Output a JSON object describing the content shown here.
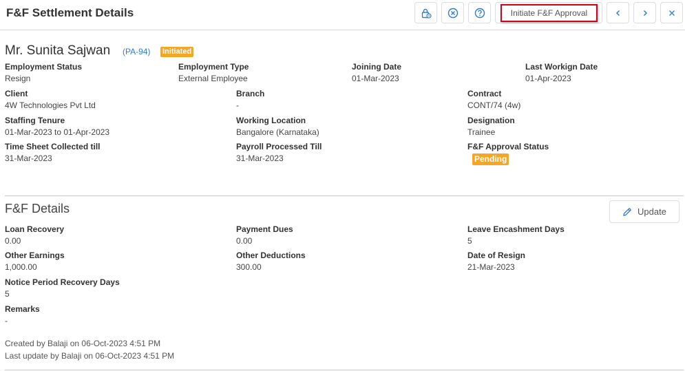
{
  "header": {
    "title": "F&F Settlement Details",
    "initiate_label": "Initiate F&F Approval"
  },
  "icons": {
    "lock": "lock-icon",
    "cancel": "cancel-circle-icon",
    "help": "help-circle-icon",
    "prev": "chevron-left-icon",
    "next": "chevron-right-icon",
    "close": "close-icon",
    "edit": "pencil-icon"
  },
  "colors": {
    "accent": "#2f7bd3",
    "badge": "#f5a623",
    "highlight": "#d0021b"
  },
  "employee": {
    "name": "Mr. Sunita Sajwan",
    "code": "(PA-94)",
    "status_badge": "Initiated"
  },
  "details": {
    "employment_status": {
      "label": "Employment Status",
      "value": "Resign"
    },
    "employment_type": {
      "label": "Employment Type",
      "value": "External Employee"
    },
    "joining_date": {
      "label": "Joining Date",
      "value": "01-Mar-2023"
    },
    "last_working_date": {
      "label": "Last Workign Date",
      "value": "01-Apr-2023"
    },
    "client": {
      "label": "Client",
      "value": "4W Technologies Pvt Ltd"
    },
    "branch": {
      "label": "Branch",
      "value": "-"
    },
    "contract": {
      "label": "Contract",
      "value": "CONT/74 (4w)"
    },
    "staffing_tenure": {
      "label": "Staffing Tenure",
      "value": "01-Mar-2023 to 01-Apr-2023"
    },
    "working_location": {
      "label": "Working Location",
      "value": "Bangalore (Karnataka)"
    },
    "designation": {
      "label": "Designation",
      "value": "Trainee"
    },
    "time_sheet": {
      "label": "Time Sheet Collected till",
      "value": "31-Mar-2023"
    },
    "payroll": {
      "label": "Payroll Processed Till",
      "value": "31-Mar-2023"
    },
    "approval_status": {
      "label": "F&F Approval Status",
      "value": "Pending"
    }
  },
  "ff": {
    "title": "F&F Details",
    "update_label": "Update",
    "loan_recovery": {
      "label": "Loan Recovery",
      "value": "0.00"
    },
    "payment_dues": {
      "label": "Payment Dues",
      "value": "0.00"
    },
    "leave_encashment": {
      "label": "Leave Encashment Days",
      "value": "5"
    },
    "other_earnings": {
      "label": "Other Earnings",
      "value": "1,000.00"
    },
    "other_deductions": {
      "label": "Other Deductions",
      "value": "300.00"
    },
    "date_of_resign": {
      "label": "Date of Resign",
      "value": "21-Mar-2023"
    },
    "notice_period": {
      "label": "Notice Period Recovery Days",
      "value": "5"
    },
    "remarks": {
      "label": "Remarks",
      "value": "-"
    }
  },
  "audit": {
    "created": "Created by Balaji on 06-Oct-2023 4:51 PM",
    "updated": "Last update by Balaji on 06-Oct-2023 4:51 PM"
  }
}
